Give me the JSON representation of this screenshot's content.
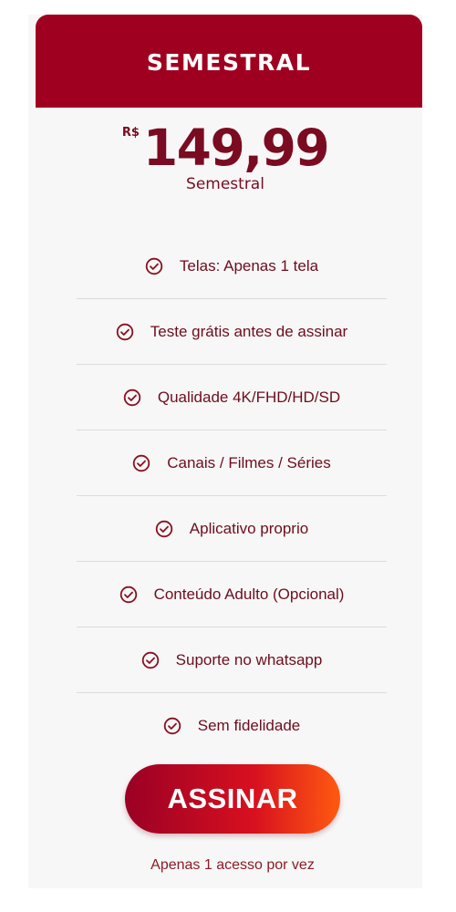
{
  "plan": {
    "title": "SEMESTRAL",
    "currency": "R$",
    "price": "149,99",
    "period": "Semestral"
  },
  "features": [
    {
      "label": "Telas: Apenas 1 tela",
      "icon": "check-circle-icon"
    },
    {
      "label": "Teste grátis antes de assinar",
      "icon": "check-circle-icon"
    },
    {
      "label": "Qualidade 4K/FHD/HD/SD",
      "icon": "check-circle-icon"
    },
    {
      "label": "Canais / Filmes / Séries",
      "icon": "check-circle-icon"
    },
    {
      "label": "Aplicativo proprio",
      "icon": "check-circle-icon"
    },
    {
      "label": "Conteúdo Adulto (Opcional)",
      "icon": "check-circle-icon"
    },
    {
      "label": "Suporte no whatsapp",
      "icon": "check-circle-icon"
    },
    {
      "label": "Sem fidelidade",
      "icon": "check-circle-icon"
    }
  ],
  "cta": {
    "label": "ASSINAR"
  },
  "note": "Apenas 1 acesso por vez",
  "colors": {
    "header_bg": "#a00020",
    "price_text": "#7a0b20",
    "feature_text": "#6d0d1e",
    "button_gradient_start": "#9a0025",
    "button_gradient_end": "#ff5a10"
  }
}
